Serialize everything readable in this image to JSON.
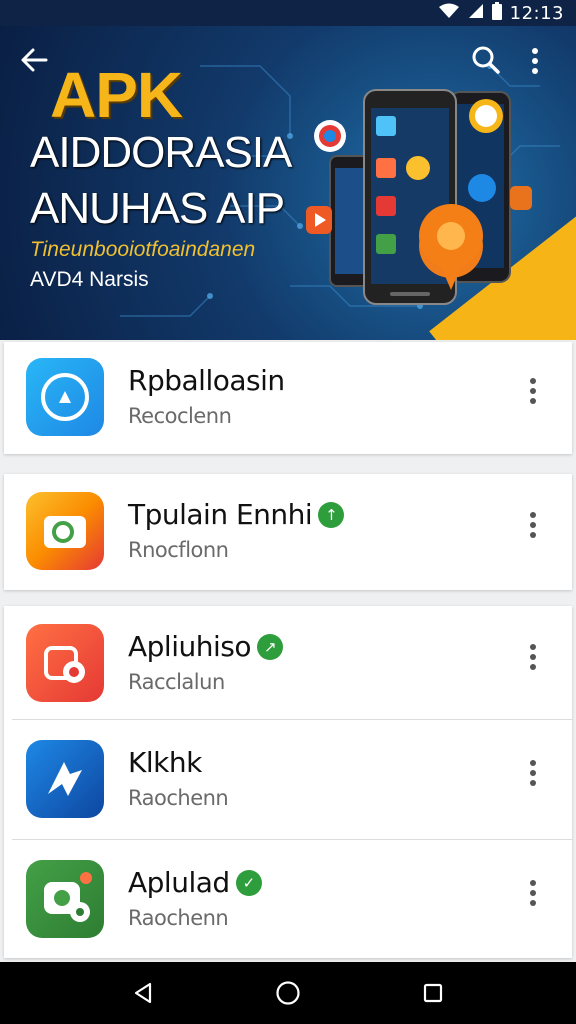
{
  "status_bar": {
    "time": "12:13",
    "icons": [
      "wifi-icon",
      "signal-icon",
      "battery-icon"
    ]
  },
  "header": {
    "nav_icons": [
      "back-arrow-icon",
      "search-icon",
      "more-vert-icon"
    ]
  },
  "banner": {
    "title": "APK",
    "line1": "AIDDORASIA",
    "line2": "ANUHAS AIP",
    "subtitle": "Tineunbooiotfoaindanen",
    "tagline": "AVD4 Narsis"
  },
  "apps": [
    {
      "name": "Rpballoasin",
      "subtitle": "Recoclenn",
      "badge": "",
      "icon": "compass-app-icon",
      "colors": [
        "#29b6f6",
        "#1e88e5"
      ]
    },
    {
      "name": "Tpulain Ennhi",
      "subtitle": "Rnocflonn",
      "badge": "↑",
      "icon": "camera-app-icon",
      "colors": [
        "#fbc02d",
        "#e53935"
      ]
    },
    {
      "name": "Apliuhiso",
      "subtitle": "Racclalun",
      "badge": "↗",
      "icon": "record-app-icon",
      "colors": [
        "#ff7043",
        "#e53935"
      ]
    },
    {
      "name": "Klkhk",
      "subtitle": "Raochenn",
      "badge": "",
      "icon": "sketch-app-icon",
      "colors": [
        "#1e88e5",
        "#0d47a1"
      ]
    },
    {
      "name": "Aplulad",
      "subtitle": "Raochenn",
      "badge": "✓",
      "icon": "camera-gear-app-icon",
      "colors": [
        "#43a047",
        "#2e7d32"
      ]
    }
  ],
  "nav_bar": {
    "icons": [
      "back-triangle-icon",
      "home-circle-icon",
      "recents-square-icon"
    ]
  },
  "colors": {
    "accent": "#f6b61a",
    "banner_bg": "#123a6b",
    "status_bar": "#0e2346",
    "verified": "#2e9d3c"
  }
}
